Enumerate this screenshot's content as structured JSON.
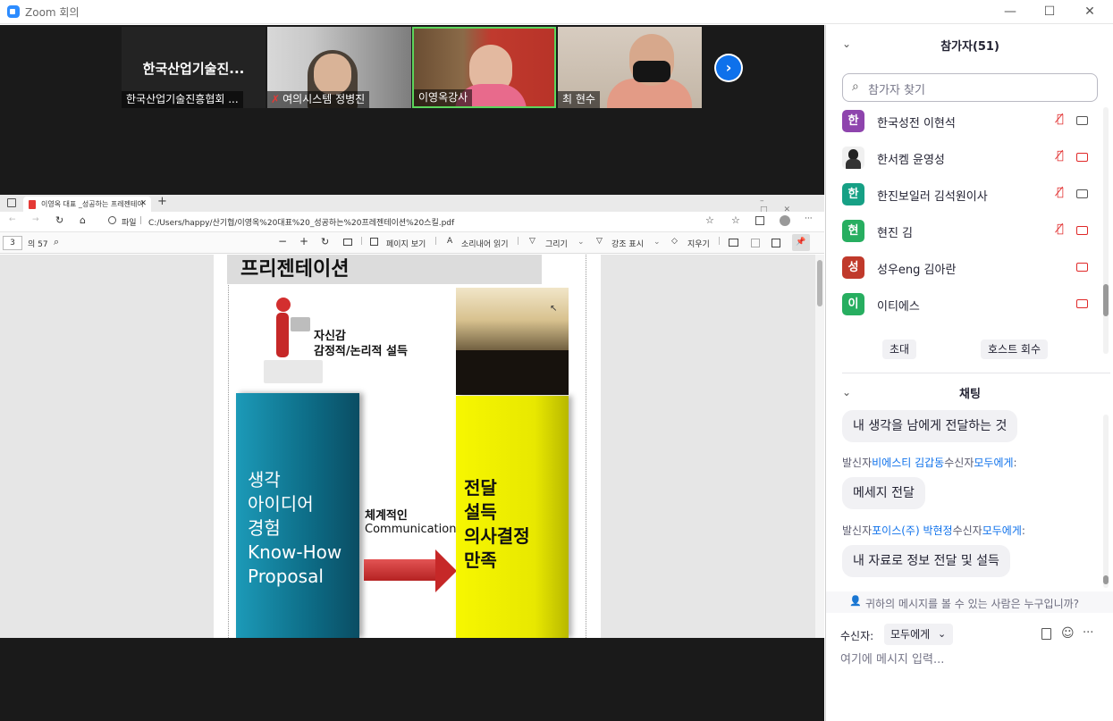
{
  "window": {
    "title": "Zoom 회의",
    "controls": {
      "minimize": "—",
      "maximize": "☐",
      "close": "✕"
    }
  },
  "gallery": {
    "tiles": [
      {
        "center_name": "한국산업기술진...",
        "label": "한국산업기술진흥협회 ..."
      },
      {
        "label": "여의시스템 정병진",
        "muted": true
      },
      {
        "label": "이영옥강사",
        "active": true
      },
      {
        "label": "최 현수"
      }
    ],
    "next_icon": "chevron-right-icon"
  },
  "pdf": {
    "tab_title": "이영옥 대표 _성공하는 프레젠테이",
    "file_label": "파일",
    "address": "C:/Users/happy/산기협/이영옥%20대표%20_성공하는%20프레젠테이션%20스킬.pdf",
    "page": "3",
    "page_total": "의 57",
    "toolbar": {
      "page_view": "페이지 보기",
      "read_aloud": "소리내어 읽기",
      "draw": "그리기",
      "highlight": "강조 표시",
      "erase": "지우기"
    },
    "slide": {
      "heading": "프리젠테이션",
      "speaker_caption_1": "자신감",
      "speaker_caption_2": "감정적/논리적 설득",
      "left_box": [
        "생각",
        "아이디어",
        "경험",
        "Know-How",
        "Proposal"
      ],
      "arrow_label_1": "체계적인",
      "arrow_label_2": "Communication",
      "right_box": [
        "전달",
        "설득",
        "의사결정",
        "만족"
      ]
    }
  },
  "participants": {
    "header": "참가자(51)",
    "search_placeholder": "참가자 찾기",
    "list": [
      {
        "initial": "한",
        "name": "한국성전 이현석",
        "color": "#8e44ad",
        "mic": "muted",
        "video": "on"
      },
      {
        "initial": "",
        "name": "한서켐 윤영성",
        "color": "#ffffff",
        "photo": true,
        "mic": "muted",
        "video": "off"
      },
      {
        "initial": "한",
        "name": "한진보일러 김석원이사",
        "color": "#16a085",
        "mic": "muted",
        "video": "on"
      },
      {
        "initial": "현",
        "name": "현진 김",
        "color": "#27ae60",
        "mic": "muted",
        "video": "off"
      },
      {
        "initial": "성",
        "name": "성우eng 김아란",
        "color": "#c0392b",
        "mic": "",
        "video": "off"
      },
      {
        "initial": "이",
        "name": "이티에스",
        "color": "#27ae60",
        "mic": "",
        "video": "off"
      }
    ],
    "invite_button": "초대",
    "reclaim_host_button": "호스트 회수"
  },
  "chat": {
    "header": "채팅",
    "messages": [
      {
        "type": "bubble",
        "text": "내 생각을 남에게 전달하는 것"
      },
      {
        "type": "sender",
        "prefix": "발신자",
        "from": "비에스티 김갑동",
        "mid": "수신자",
        "to": "모두에게",
        "suffix": ":"
      },
      {
        "type": "bubble",
        "text": "메세지 전달"
      },
      {
        "type": "sender",
        "prefix": "발신자",
        "from": "포이스(주) 박현정",
        "mid": "수신자",
        "to": "모두에게",
        "suffix": ":"
      },
      {
        "type": "bubble",
        "text": "내 자료로 정보 전달 및 설득"
      }
    ],
    "visibility_note": "귀하의 메시지를 볼 수 있는 사람은 누구입니까?",
    "recipient_label": "수신자:",
    "recipient_value": "모두에게",
    "input_placeholder": "여기에 메시지 입력..."
  }
}
